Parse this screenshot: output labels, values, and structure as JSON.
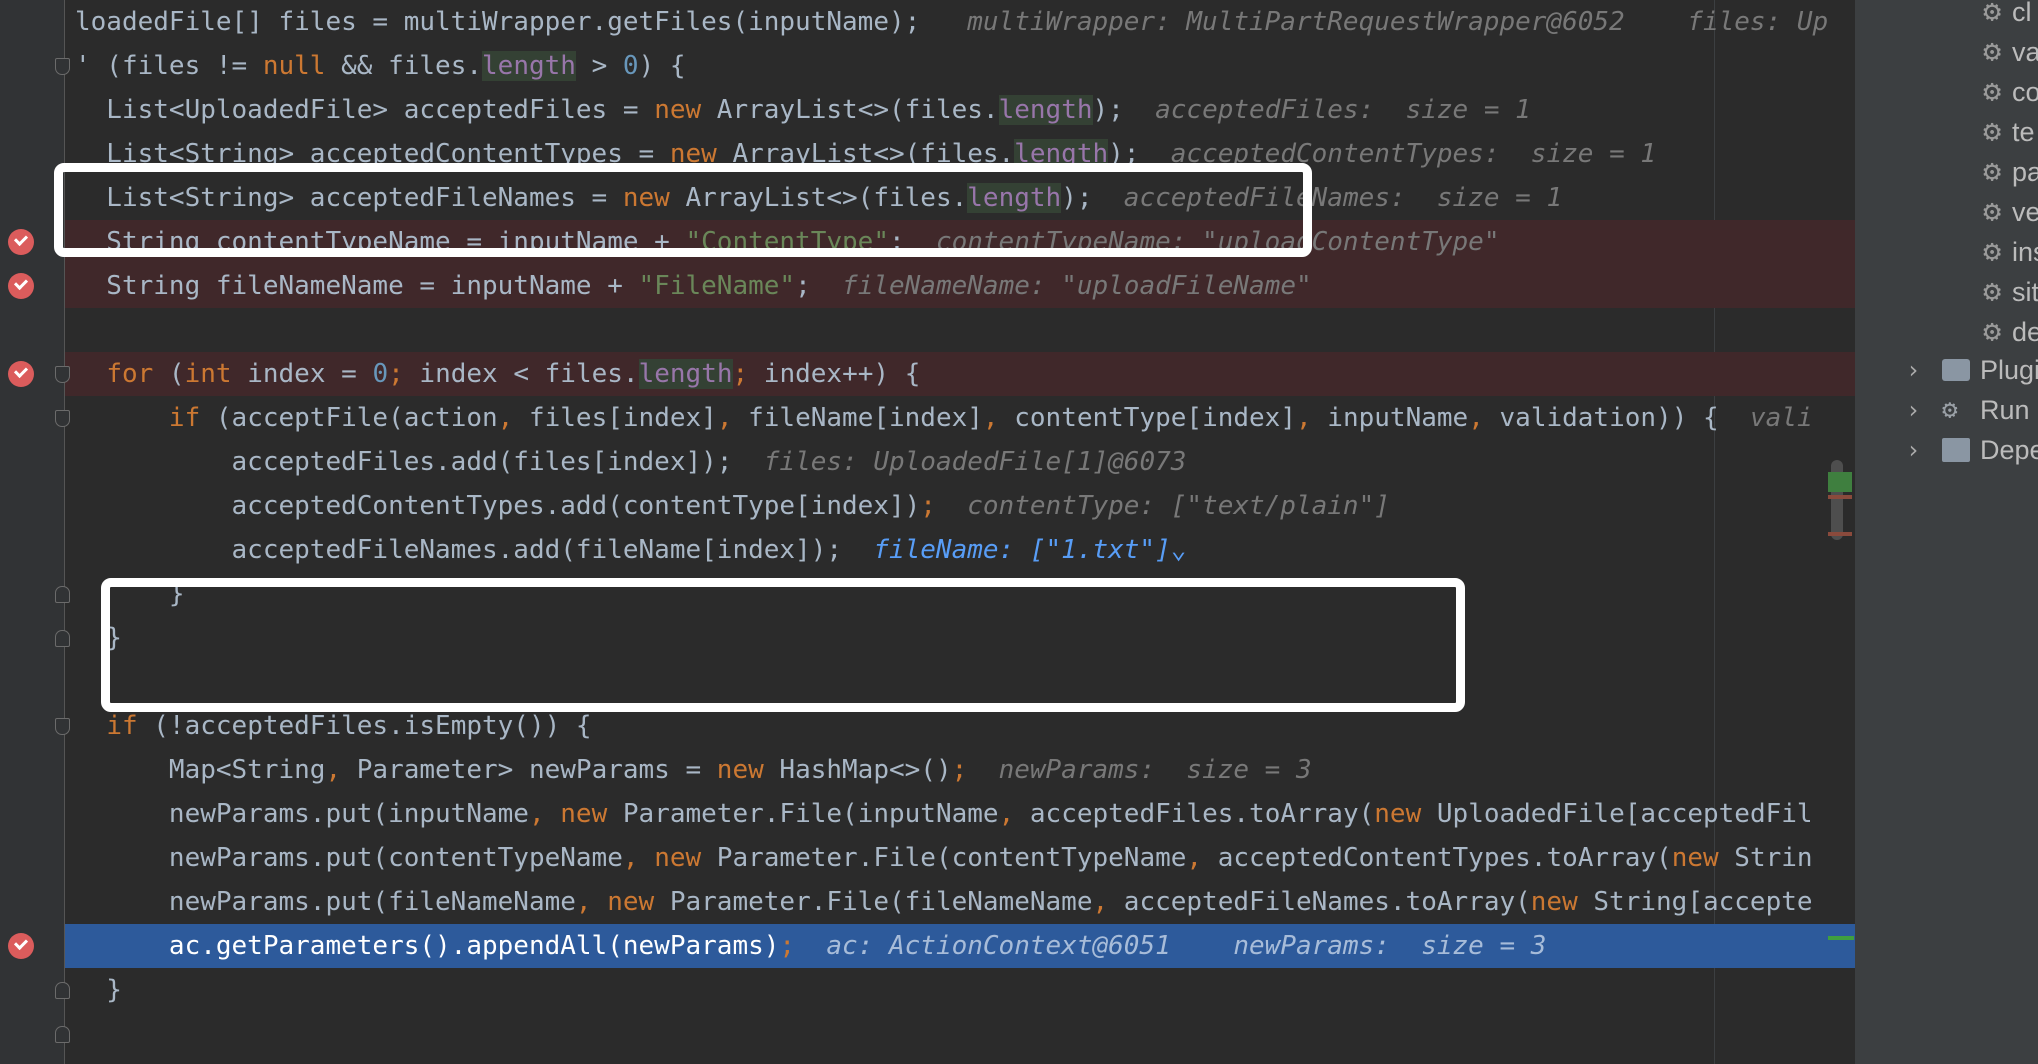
{
  "editor": {
    "lines": [
      {
        "gutter": "none",
        "fold": "none",
        "bg": "",
        "segments": [
          {
            "c": "t",
            "t": "loadedFile[] files = multiWrapper.getFiles(inputName);"
          },
          {
            "c": "hint",
            "t": "   multiWrapper: MultiPartRequestWrapper@6052    files: Up"
          }
        ]
      },
      {
        "gutter": "none",
        "fold": "start",
        "bg": "",
        "segments": [
          {
            "c": "t",
            "t": "' (files != "
          },
          {
            "c": "k",
            "t": "null"
          },
          {
            "c": "t",
            "t": " && files."
          },
          {
            "c": "f hl",
            "t": "length"
          },
          {
            "c": "t",
            "t": " > "
          },
          {
            "c": "n",
            "t": "0"
          },
          {
            "c": "t",
            "t": ") {"
          }
        ]
      },
      {
        "gutter": "none",
        "fold": "none",
        "bg": "",
        "segments": [
          {
            "c": "t",
            "t": "  List<UploadedFile> acceptedFiles = "
          },
          {
            "c": "k",
            "t": "new"
          },
          {
            "c": "t",
            "t": " ArrayList<>(files."
          },
          {
            "c": "f hl",
            "t": "length"
          },
          {
            "c": "t",
            "t": ");"
          },
          {
            "c": "hint",
            "t": "  acceptedFiles:  "
          },
          {
            "c": "hint sz",
            "t": "size = 1"
          }
        ]
      },
      {
        "gutter": "none",
        "fold": "none",
        "bg": "",
        "segments": [
          {
            "c": "t",
            "t": "  List<String> acceptedContentTypes = "
          },
          {
            "c": "k",
            "t": "new"
          },
          {
            "c": "t",
            "t": " ArrayList<>(files."
          },
          {
            "c": "f hl",
            "t": "length"
          },
          {
            "c": "t",
            "t": ");"
          },
          {
            "c": "hint",
            "t": "  acceptedContentTypes:  "
          },
          {
            "c": "hint sz",
            "t": "size = 1"
          }
        ]
      },
      {
        "gutter": "none",
        "fold": "none",
        "bg": "",
        "segments": [
          {
            "c": "t",
            "t": "  List<String> acceptedFileNames = "
          },
          {
            "c": "k",
            "t": "new"
          },
          {
            "c": "t",
            "t": " ArrayList<>(files."
          },
          {
            "c": "f hl",
            "t": "length"
          },
          {
            "c": "t",
            "t": ");"
          },
          {
            "c": "hint",
            "t": "  acceptedFileNames:  "
          },
          {
            "c": "hint sz",
            "t": "size = 1"
          }
        ]
      },
      {
        "gutter": "bp",
        "fold": "none",
        "bg": "bp",
        "segments": [
          {
            "c": "t",
            "t": "  String contentTypeName = inputName + "
          },
          {
            "c": "s",
            "t": "\"ContentType\""
          },
          {
            "c": "t",
            "t": ";"
          },
          {
            "c": "hint",
            "t": "  contentTypeName: \"uploadContentType\""
          }
        ]
      },
      {
        "gutter": "bp",
        "fold": "none",
        "bg": "bp",
        "segments": [
          {
            "c": "t",
            "t": "  String fileNameName = inputName + "
          },
          {
            "c": "s",
            "t": "\"FileName\""
          },
          {
            "c": "t",
            "t": ";"
          },
          {
            "c": "hint",
            "t": "  fileNameName: \"uploadFileName\""
          }
        ]
      },
      {
        "gutter": "none",
        "fold": "none",
        "bg": "",
        "segments": []
      },
      {
        "gutter": "bp",
        "fold": "start",
        "bg": "bp",
        "segments": [
          {
            "c": "t",
            "t": "  "
          },
          {
            "c": "k",
            "t": "for"
          },
          {
            "c": "t",
            "t": " ("
          },
          {
            "c": "k",
            "t": "int"
          },
          {
            "c": "t",
            "t": " index = "
          },
          {
            "c": "n",
            "t": "0"
          },
          {
            "c": "k",
            "t": ";"
          },
          {
            "c": "t",
            "t": " index < files."
          },
          {
            "c": "f hl",
            "t": "length"
          },
          {
            "c": "k",
            "t": ";"
          },
          {
            "c": "t",
            "t": " index++) {"
          }
        ]
      },
      {
        "gutter": "none",
        "fold": "start",
        "bg": "",
        "segments": [
          {
            "c": "t",
            "t": "      "
          },
          {
            "c": "k",
            "t": "if"
          },
          {
            "c": "t",
            "t": " (acceptFile(action"
          },
          {
            "c": "k",
            "t": ","
          },
          {
            "c": "t",
            "t": " files[index]"
          },
          {
            "c": "k",
            "t": ","
          },
          {
            "c": "t",
            "t": " fileName[index]"
          },
          {
            "c": "k",
            "t": ","
          },
          {
            "c": "t",
            "t": " contentType[index]"
          },
          {
            "c": "k",
            "t": ","
          },
          {
            "c": "t",
            "t": " inputName"
          },
          {
            "c": "k",
            "t": ","
          },
          {
            "c": "t",
            "t": " validation)) {"
          },
          {
            "c": "hint",
            "t": "  vali"
          }
        ]
      },
      {
        "gutter": "none",
        "fold": "none",
        "bg": "",
        "segments": [
          {
            "c": "t",
            "t": "          acceptedFiles.add(files[index]);"
          },
          {
            "c": "hint",
            "t": "  files: UploadedFile[1]@6073"
          }
        ]
      },
      {
        "gutter": "none",
        "fold": "none",
        "bg": "",
        "segments": [
          {
            "c": "t",
            "t": "          acceptedContentTypes.add(contentType[index])"
          },
          {
            "c": "k",
            "t": ";"
          },
          {
            "c": "hint",
            "t": "  contentType: [\"text/plain\"]"
          }
        ]
      },
      {
        "gutter": "none",
        "fold": "none",
        "bg": "",
        "segments": [
          {
            "c": "t",
            "t": "          acceptedFileNames.add(fileName[index]);"
          },
          {
            "c": "hint act",
            "t": "  fileName: [\"1.txt\"]⌄"
          }
        ]
      },
      {
        "gutter": "none",
        "fold": "end",
        "bg": "",
        "segments": [
          {
            "c": "t",
            "t": "      }"
          }
        ]
      },
      {
        "gutter": "none",
        "fold": "end",
        "bg": "",
        "segments": [
          {
            "c": "t",
            "t": "  }"
          }
        ]
      },
      {
        "gutter": "none",
        "fold": "none",
        "bg": "",
        "segments": []
      },
      {
        "gutter": "none",
        "fold": "start",
        "bg": "",
        "segments": [
          {
            "c": "t",
            "t": "  "
          },
          {
            "c": "k",
            "t": "if"
          },
          {
            "c": "t",
            "t": " (!acceptedFiles.isEmpty()) {"
          }
        ]
      },
      {
        "gutter": "none",
        "fold": "none",
        "bg": "",
        "segments": [
          {
            "c": "t",
            "t": "      Map<String"
          },
          {
            "c": "k",
            "t": ","
          },
          {
            "c": "t",
            "t": " Parameter> newParams = "
          },
          {
            "c": "k",
            "t": "new"
          },
          {
            "c": "t",
            "t": " HashMap<>()"
          },
          {
            "c": "k",
            "t": ";"
          },
          {
            "c": "hint",
            "t": "  newParams:  size = 3"
          }
        ]
      },
      {
        "gutter": "none",
        "fold": "none",
        "bg": "",
        "segments": [
          {
            "c": "t",
            "t": "      newParams.put(inputName"
          },
          {
            "c": "k",
            "t": ","
          },
          {
            "c": "t",
            "t": " "
          },
          {
            "c": "k",
            "t": "new"
          },
          {
            "c": "t",
            "t": " Parameter.File(inputName"
          },
          {
            "c": "k",
            "t": ","
          },
          {
            "c": "t",
            "t": " acceptedFiles.toArray("
          },
          {
            "c": "k",
            "t": "new"
          },
          {
            "c": "t",
            "t": " UploadedFile[acceptedFil"
          }
        ]
      },
      {
        "gutter": "none",
        "fold": "none",
        "bg": "",
        "segments": [
          {
            "c": "t",
            "t": "      newParams.put(contentTypeName"
          },
          {
            "c": "k",
            "t": ","
          },
          {
            "c": "t",
            "t": " "
          },
          {
            "c": "k",
            "t": "new"
          },
          {
            "c": "t",
            "t": " Parameter.File(contentTypeName"
          },
          {
            "c": "k",
            "t": ","
          },
          {
            "c": "t",
            "t": " acceptedContentTypes.toArray("
          },
          {
            "c": "k",
            "t": "new"
          },
          {
            "c": "t",
            "t": " Strin"
          }
        ]
      },
      {
        "gutter": "none",
        "fold": "none",
        "bg": "",
        "segments": [
          {
            "c": "t",
            "t": "      newParams.put(fileNameName"
          },
          {
            "c": "k",
            "t": ","
          },
          {
            "c": "t",
            "t": " "
          },
          {
            "c": "k",
            "t": "new"
          },
          {
            "c": "t",
            "t": " Parameter.File(fileNameName"
          },
          {
            "c": "k",
            "t": ","
          },
          {
            "c": "t",
            "t": " acceptedFileNames.toArray("
          },
          {
            "c": "k",
            "t": "new"
          },
          {
            "c": "t",
            "t": " String[accepte"
          }
        ]
      },
      {
        "gutter": "bp",
        "fold": "none",
        "bg": "exec",
        "segments": [
          {
            "c": "t",
            "t": "      ac.getParameters().appendAll(newParams)"
          },
          {
            "c": "k",
            "t": ";"
          },
          {
            "c": "hint",
            "t": "  ac: ActionContext@6051    newParams:  size = 3"
          }
        ]
      },
      {
        "gutter": "none",
        "fold": "end",
        "bg": "",
        "segments": [
          {
            "c": "t",
            "t": "  }"
          }
        ]
      },
      {
        "gutter": "none",
        "fold": "end",
        "bg": "",
        "segments": []
      }
    ]
  },
  "panel": {
    "settings": [
      "cl",
      "va",
      "co",
      "te",
      "pa",
      "ve",
      "ins",
      "sit",
      "de"
    ],
    "nodes": [
      {
        "icon": "folder-gear-icon",
        "label": "Plugi"
      },
      {
        "icon": "gear-icon",
        "label": "Run C"
      },
      {
        "icon": "bar-chart-icon",
        "label": "Depe"
      }
    ]
  },
  "colors": {
    "breakpoint": "#db5c5c",
    "execution_line": "#2d5a9b",
    "keyword": "#cc7832",
    "string": "#6a8759",
    "number": "#6897bb",
    "field": "#9876aa",
    "annotation_frame": "#ffffff"
  }
}
